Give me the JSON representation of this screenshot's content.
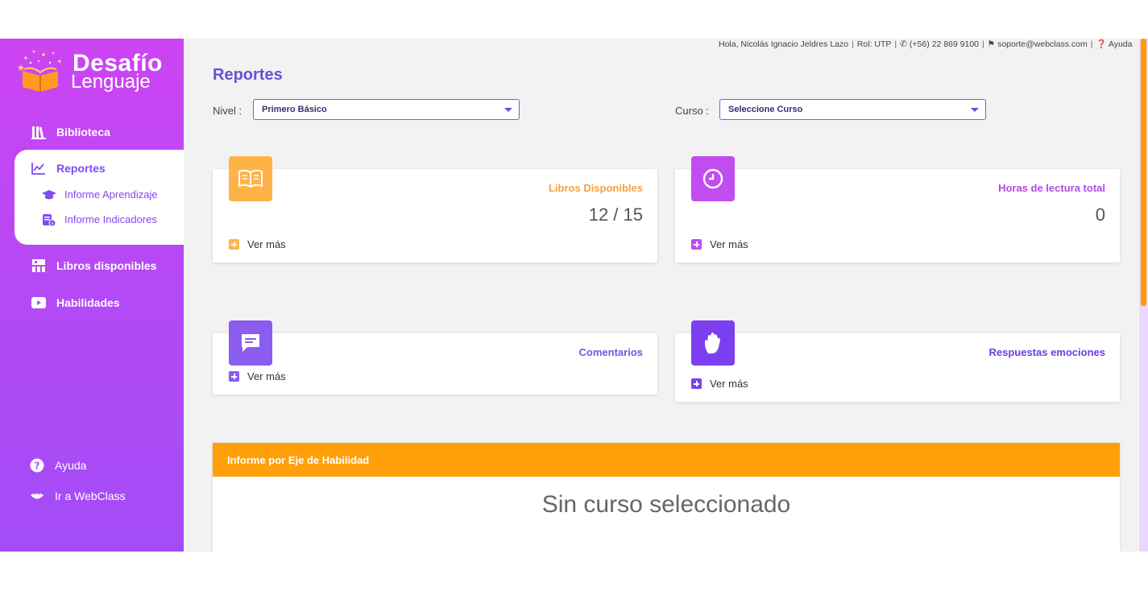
{
  "brand": {
    "line1": "Desafío",
    "line2": "Lenguaje"
  },
  "sidebar": {
    "biblioteca": "Biblioteca",
    "reportes": "Reportes",
    "sub": [
      "Informe Aprendizaje",
      "Informe Indicadores"
    ],
    "libros": "Libros disponibles",
    "habilidades": "Habilidades",
    "ayuda": "Ayuda",
    "webclass": "Ir a WebClass"
  },
  "topbar": {
    "greeting": "Hola, Nicolás Ignacio Jeldres Lazo",
    "rol": "Rol: UTP",
    "phone": "(+56) 22 869 9100",
    "email": "soporte@webclass.com",
    "help": "Ayuda",
    "separator": "|"
  },
  "page": {
    "title": "Reportes"
  },
  "filters": {
    "nivel_label": "Nivel :",
    "nivel_value": "Primero Básico",
    "curso_label": "Curso :",
    "curso_value": "Seleccione Curso"
  },
  "cards": [
    {
      "title": "Libros Disponibles",
      "value": "12 / 15",
      "more": "Ver más",
      "color": "#ffb347"
    },
    {
      "title": "Horas de lectura total",
      "value": "0",
      "more": "Ver más",
      "color": "#c14cf0"
    },
    {
      "title": "Comentarios",
      "value": "",
      "more": "Ver más",
      "color": "#8a5cf0"
    },
    {
      "title": "Respuestas emociones",
      "value": "",
      "more": "Ver más",
      "color": "#7b3ff0"
    }
  ],
  "report": {
    "header": "Informe por Eje de Habilidad",
    "empty": "Sin curso seleccionado"
  },
  "colors": {
    "accent": "#7e4cf0",
    "orange": "#ff9f0a",
    "sidebar_top": "#cd44f3",
    "sidebar_bottom": "#a34cf6"
  }
}
